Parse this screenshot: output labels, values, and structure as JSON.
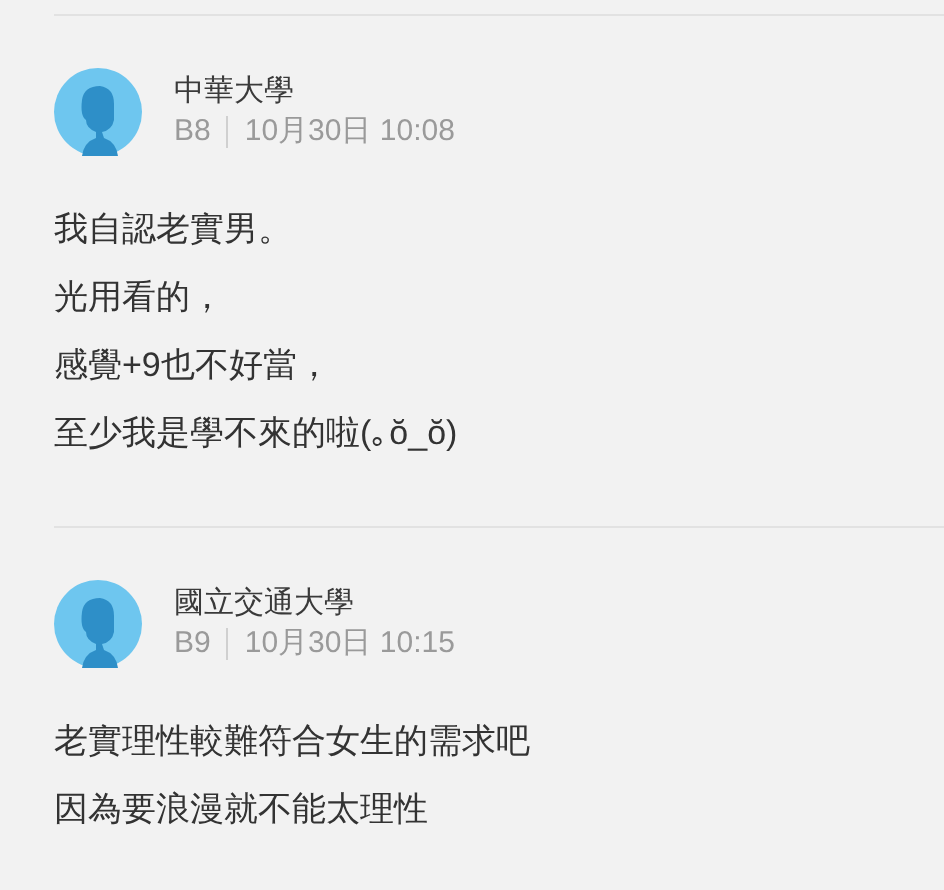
{
  "comments": [
    {
      "school": "中華大學",
      "floor": "B8",
      "time": "10月30日 10:08",
      "lines": [
        "我自認老實男。",
        "光用看的，",
        "感覺+9也不好當，",
        "至少我是學不來的啦(｡ŏ_ŏ)"
      ]
    },
    {
      "school": "國立交通大學",
      "floor": "B9",
      "time": "10月30日 10:15",
      "lines": [
        "老實理性較難符合女生的需求吧",
        "因為要浪漫就不能太理性"
      ]
    }
  ]
}
